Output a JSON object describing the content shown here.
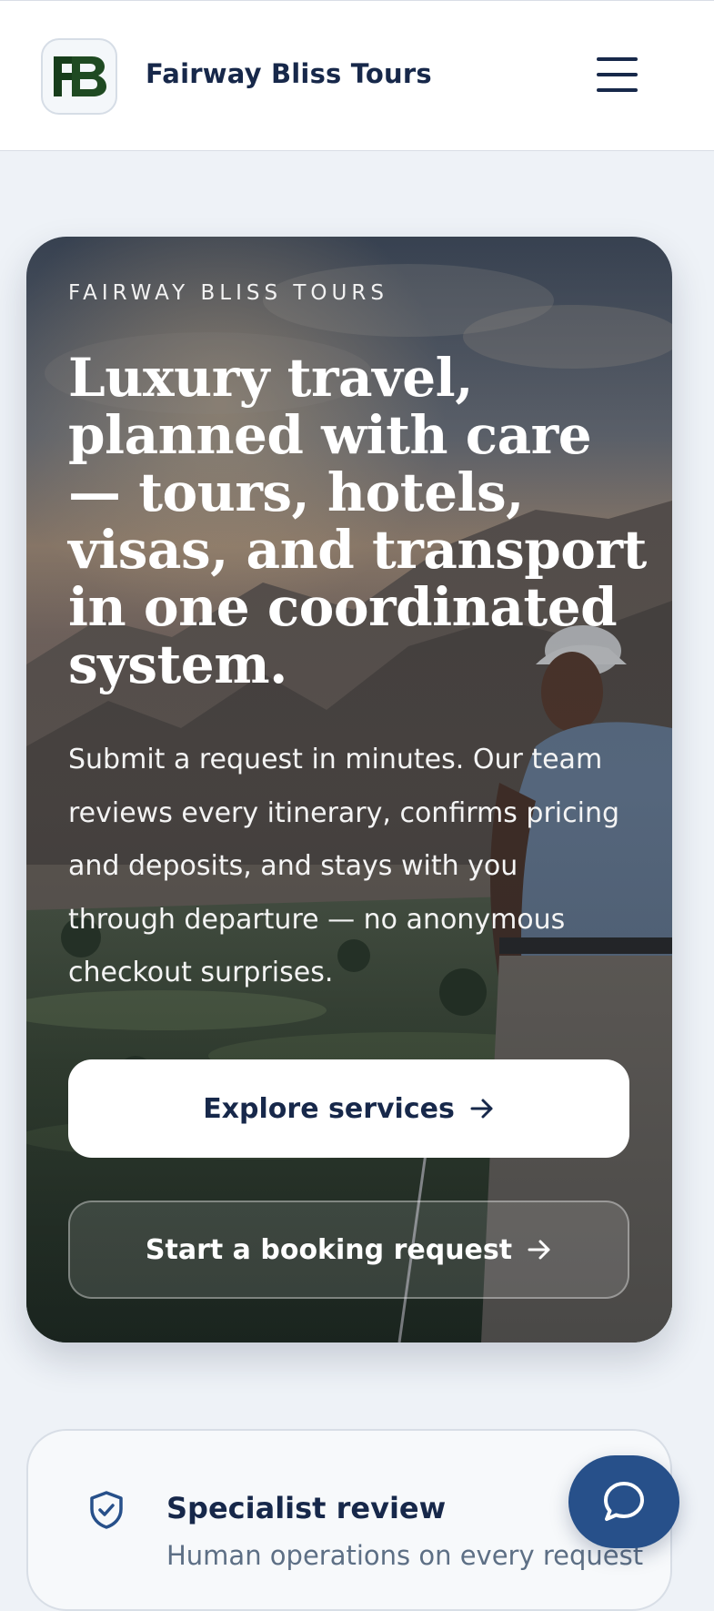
{
  "header": {
    "brand_name": "Fairway Bliss Tours",
    "logo_icon": "fb-monogram-logo",
    "menu_icon": "hamburger-menu-icon"
  },
  "hero": {
    "eyebrow": "FAIRWAY BLISS TOURS",
    "title": "Luxury travel, planned with care — tours, hotels, visas, and transport in one coordinated system.",
    "description": "Submit a request in minutes. Our team reviews every itinerary, confirms pricing and deposits, and stays with you through departure — no anonymous checkout surprises.",
    "primary_button": "Explore services",
    "secondary_button": "Start a booking request",
    "arrow_icon": "arrow-right-icon"
  },
  "feature_card": {
    "icon": "shield-check-icon",
    "title": "Specialist review",
    "subtitle": "Human operations on every request"
  },
  "chat": {
    "icon": "chat-bubble-icon"
  },
  "colors": {
    "brand_navy": "#17284a",
    "chat_blue": "#27508a",
    "logo_green": "#1f4a22",
    "page_bg": "#eef2f7"
  }
}
